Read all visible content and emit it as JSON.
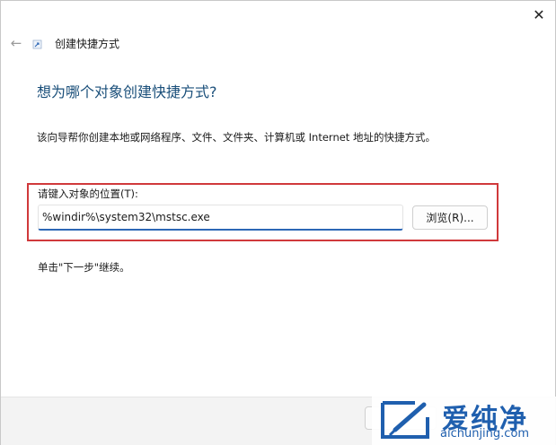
{
  "window": {
    "title": "创建快捷方式",
    "close_symbol": "✕",
    "back_symbol": "←"
  },
  "main": {
    "heading": "想为哪个对象创建快捷方式?",
    "description": "该向导帮你创建本地或网络程序、文件、文件夹、计算机或 Internet 地址的快捷方式。",
    "field_label": "请键入对象的位置(T):",
    "location_value": "%windir%\\system32\\mstsc.exe",
    "browse_label": "浏览(R)...",
    "instruction": "单击\"下一步\"继续。"
  },
  "colors": {
    "heading": "#1a4f7a",
    "highlight": "#d0393b",
    "input_accent": "#2d67b6",
    "watermark": "#1f5fae"
  },
  "watermark": {
    "brand_cn": "爱纯净",
    "url": "aichunjing.com"
  }
}
